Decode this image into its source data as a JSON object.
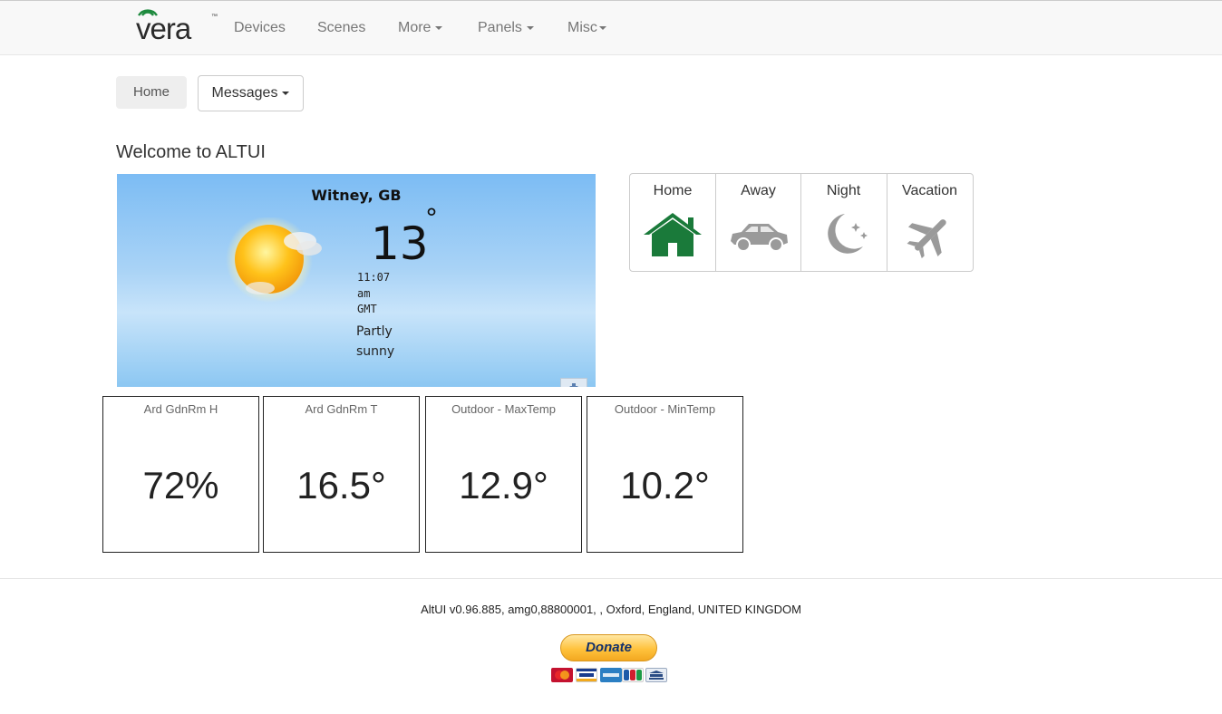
{
  "nav": {
    "brand": "vera",
    "brand_mark": "™",
    "items": [
      {
        "label": "Devices",
        "dropdown": false
      },
      {
        "label": "Scenes",
        "dropdown": false
      },
      {
        "label": "More",
        "dropdown": true
      },
      {
        "label": "Panels",
        "dropdown": true
      },
      {
        "label": "Misc",
        "dropdown": true
      }
    ]
  },
  "breadcrumb": {
    "home": "Home",
    "messages": "Messages"
  },
  "page_title": "Welcome to ALTUI",
  "weather": {
    "city": "Witney, GB",
    "temperature": "13",
    "degree_symbol": "°",
    "time_lines": [
      "11:07",
      "am",
      "GMT"
    ],
    "condition_lines": [
      "Partly",
      "sunny"
    ],
    "icon": "sun-partly-cloudy-icon"
  },
  "house_modes": [
    {
      "label": "Home",
      "icon": "house-icon",
      "active": true,
      "color": "#1a7a3a"
    },
    {
      "label": "Away",
      "icon": "car-icon",
      "active": false,
      "color": "#9a9a9a"
    },
    {
      "label": "Night",
      "icon": "moon-stars-icon",
      "active": false,
      "color": "#9a9a9a"
    },
    {
      "label": "Vacation",
      "icon": "airplane-icon",
      "active": false,
      "color": "#9a9a9a"
    }
  ],
  "tiles": [
    {
      "name": "Ard GdnRm H",
      "value": "72%"
    },
    {
      "name": "Ard GdnRm T",
      "value": "16.5°"
    },
    {
      "name": "Outdoor - MaxTemp",
      "value": "12.9°"
    },
    {
      "name": "Outdoor - MinTemp",
      "value": "10.2°"
    }
  ],
  "footer": {
    "version_text": "AltUI v0.96.885, amg0,88800001, , Oxford, England, UNITED KINGDOM",
    "donate_label": "Donate",
    "payment_cards": [
      "mastercard",
      "visa",
      "amex",
      "jcb",
      "bank"
    ]
  }
}
